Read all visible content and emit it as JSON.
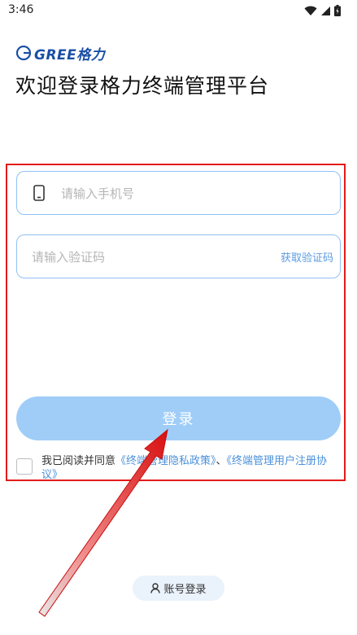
{
  "status_bar": {
    "time": "3:46"
  },
  "brand": {
    "logo_text": "GREE格力",
    "color": "#1b4fa6"
  },
  "page_title": "欢迎登录格力终端管理平台",
  "form": {
    "phone_placeholder": "请输入手机号",
    "code_placeholder": "请输入验证码",
    "get_code_label": "获取验证码",
    "login_label": "登录"
  },
  "agreement": {
    "prefix": "我已阅读并同意",
    "privacy_link": "《终端管理隐私政策》",
    "separator": "、",
    "user_agreement_link": "《终端管理用户注册协议》",
    "checked": false
  },
  "account_login_label": "账号登录",
  "colors": {
    "accent": "#4a90d9",
    "field_border": "#8fc1f4",
    "login_button": "#9fcdf8",
    "annotation": "#e21b1b"
  },
  "icons": [
    "wifi-icon",
    "signal-icon",
    "battery-icon",
    "phone-icon",
    "user-icon"
  ]
}
